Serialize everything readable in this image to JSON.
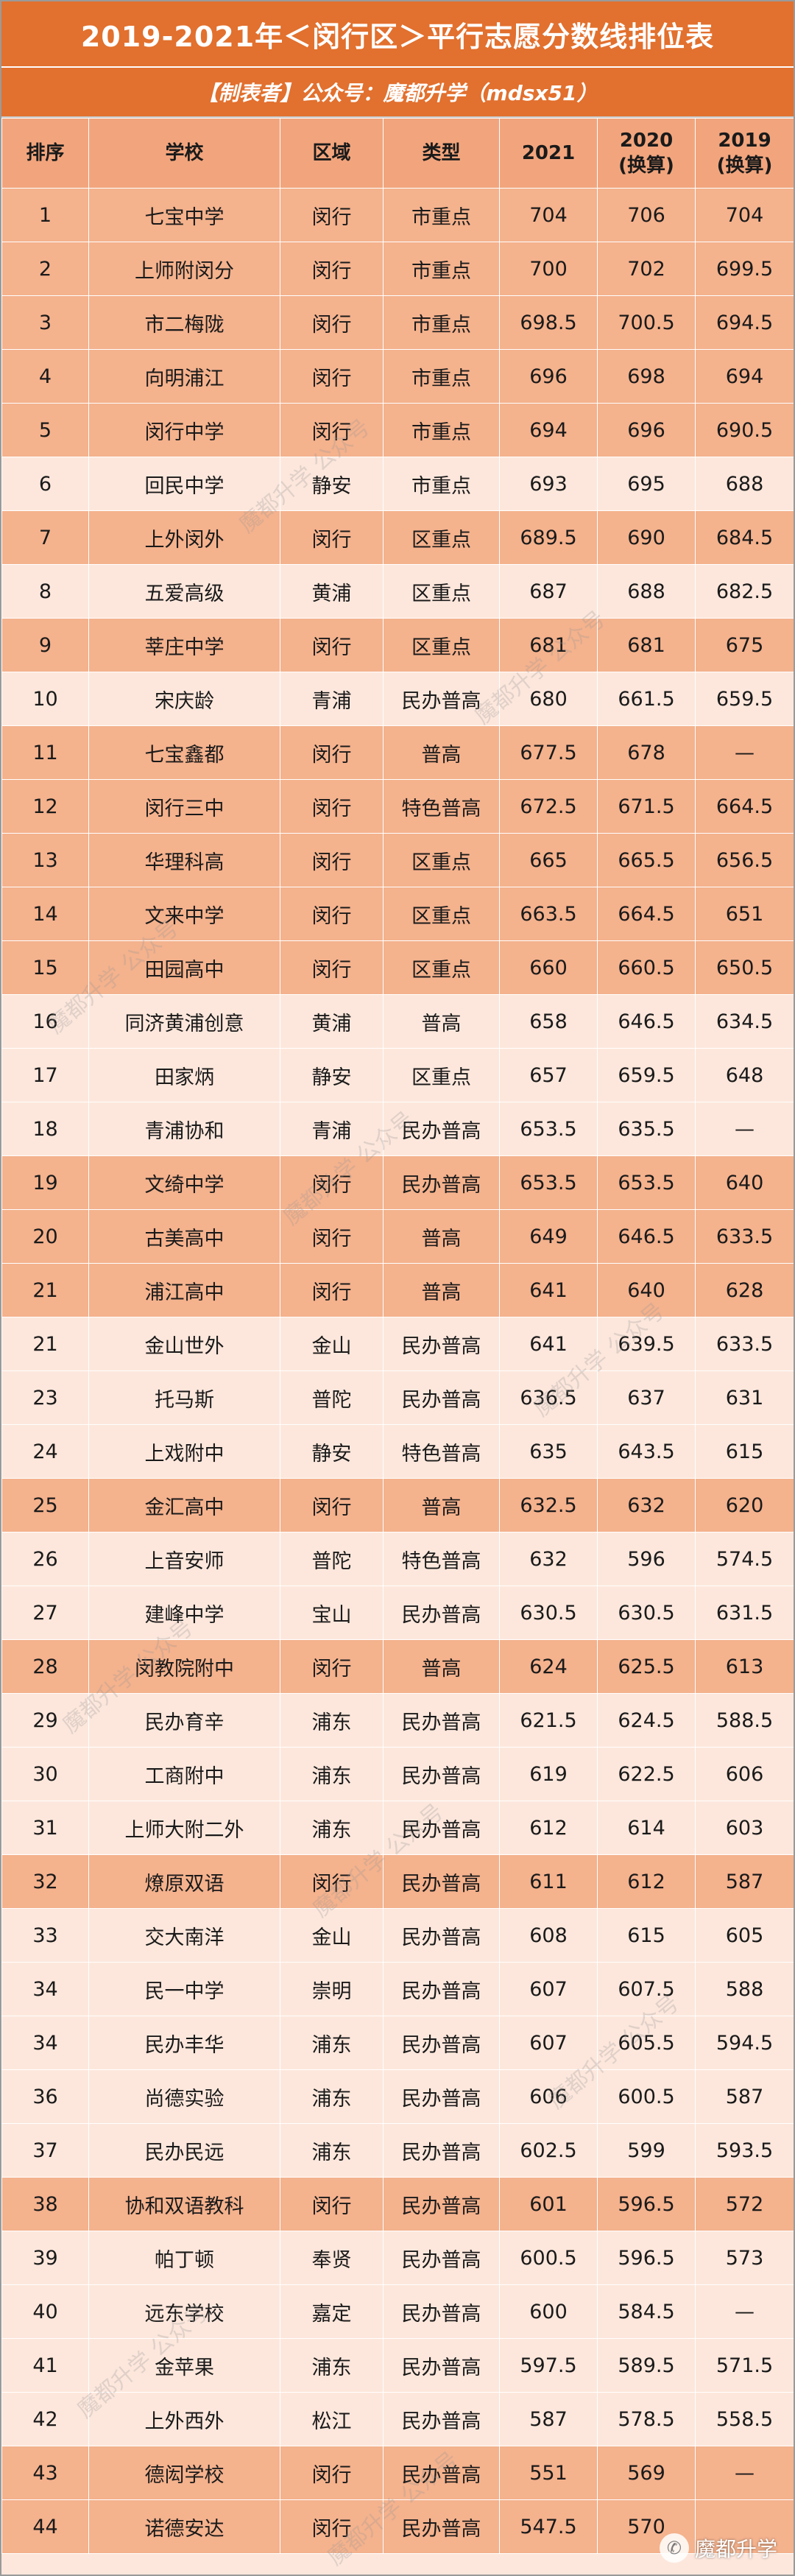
{
  "title": "2019-2021年＜闵行区＞平行志愿分数线排位表",
  "credit": "【制表者】公众号：魔都升学（mdsx51）",
  "columns": [
    "排序",
    "学校",
    "区域",
    "类型",
    "2021",
    "2020\n(换算)",
    "2019\n(换算)"
  ],
  "rows": [
    {
      "rank": "1",
      "school": "七宝中学",
      "district": "闵行",
      "type": "市重点",
      "y2021": "704",
      "y2020": "706",
      "y2019": "704",
      "highlight": true
    },
    {
      "rank": "2",
      "school": "上师附闵分",
      "district": "闵行",
      "type": "市重点",
      "y2021": "700",
      "y2020": "702",
      "y2019": "699.5",
      "highlight": true
    },
    {
      "rank": "3",
      "school": "市二梅陇",
      "district": "闵行",
      "type": "市重点",
      "y2021": "698.5",
      "y2020": "700.5",
      "y2019": "694.5",
      "highlight": true
    },
    {
      "rank": "4",
      "school": "向明浦江",
      "district": "闵行",
      "type": "市重点",
      "y2021": "696",
      "y2020": "698",
      "y2019": "694",
      "highlight": true
    },
    {
      "rank": "5",
      "school": "闵行中学",
      "district": "闵行",
      "type": "市重点",
      "y2021": "694",
      "y2020": "696",
      "y2019": "690.5",
      "highlight": true
    },
    {
      "rank": "6",
      "school": "回民中学",
      "district": "静安",
      "type": "市重点",
      "y2021": "693",
      "y2020": "695",
      "y2019": "688",
      "highlight": false
    },
    {
      "rank": "7",
      "school": "上外闵外",
      "district": "闵行",
      "type": "区重点",
      "y2021": "689.5",
      "y2020": "690",
      "y2019": "684.5",
      "highlight": true
    },
    {
      "rank": "8",
      "school": "五爱高级",
      "district": "黄浦",
      "type": "区重点",
      "y2021": "687",
      "y2020": "688",
      "y2019": "682.5",
      "highlight": false
    },
    {
      "rank": "9",
      "school": "莘庄中学",
      "district": "闵行",
      "type": "区重点",
      "y2021": "681",
      "y2020": "681",
      "y2019": "675",
      "highlight": true
    },
    {
      "rank": "10",
      "school": "宋庆龄",
      "district": "青浦",
      "type": "民办普高",
      "y2021": "680",
      "y2020": "661.5",
      "y2019": "659.5",
      "highlight": false
    },
    {
      "rank": "11",
      "school": "七宝鑫都",
      "district": "闵行",
      "type": "普高",
      "y2021": "677.5",
      "y2020": "678",
      "y2019": "—",
      "highlight": true
    },
    {
      "rank": "12",
      "school": "闵行三中",
      "district": "闵行",
      "type": "特色普高",
      "y2021": "672.5",
      "y2020": "671.5",
      "y2019": "664.5",
      "highlight": true
    },
    {
      "rank": "13",
      "school": "华理科高",
      "district": "闵行",
      "type": "区重点",
      "y2021": "665",
      "y2020": "665.5",
      "y2019": "656.5",
      "highlight": true
    },
    {
      "rank": "14",
      "school": "文来中学",
      "district": "闵行",
      "type": "区重点",
      "y2021": "663.5",
      "y2020": "664.5",
      "y2019": "651",
      "highlight": true
    },
    {
      "rank": "15",
      "school": "田园高中",
      "district": "闵行",
      "type": "区重点",
      "y2021": "660",
      "y2020": "660.5",
      "y2019": "650.5",
      "highlight": true
    },
    {
      "rank": "16",
      "school": "同济黄浦创意",
      "district": "黄浦",
      "type": "普高",
      "y2021": "658",
      "y2020": "646.5",
      "y2019": "634.5",
      "highlight": false
    },
    {
      "rank": "17",
      "school": "田家炳",
      "district": "静安",
      "type": "区重点",
      "y2021": "657",
      "y2020": "659.5",
      "y2019": "648",
      "highlight": false
    },
    {
      "rank": "18",
      "school": "青浦协和",
      "district": "青浦",
      "type": "民办普高",
      "y2021": "653.5",
      "y2020": "635.5",
      "y2019": "—",
      "highlight": false
    },
    {
      "rank": "19",
      "school": "文绮中学",
      "district": "闵行",
      "type": "民办普高",
      "y2021": "653.5",
      "y2020": "653.5",
      "y2019": "640",
      "highlight": true
    },
    {
      "rank": "20",
      "school": "古美高中",
      "district": "闵行",
      "type": "普高",
      "y2021": "649",
      "y2020": "646.5",
      "y2019": "633.5",
      "highlight": true
    },
    {
      "rank": "21",
      "school": "浦江高中",
      "district": "闵行",
      "type": "普高",
      "y2021": "641",
      "y2020": "640",
      "y2019": "628",
      "highlight": true
    },
    {
      "rank": "21",
      "school": "金山世外",
      "district": "金山",
      "type": "民办普高",
      "y2021": "641",
      "y2020": "639.5",
      "y2019": "633.5",
      "highlight": false
    },
    {
      "rank": "23",
      "school": "托马斯",
      "district": "普陀",
      "type": "民办普高",
      "y2021": "636.5",
      "y2020": "637",
      "y2019": "631",
      "highlight": false
    },
    {
      "rank": "24",
      "school": "上戏附中",
      "district": "静安",
      "type": "特色普高",
      "y2021": "635",
      "y2020": "643.5",
      "y2019": "615",
      "highlight": false
    },
    {
      "rank": "25",
      "school": "金汇高中",
      "district": "闵行",
      "type": "普高",
      "y2021": "632.5",
      "y2020": "632",
      "y2019": "620",
      "highlight": true
    },
    {
      "rank": "26",
      "school": "上音安师",
      "district": "普陀",
      "type": "特色普高",
      "y2021": "632",
      "y2020": "596",
      "y2019": "574.5",
      "highlight": false
    },
    {
      "rank": "27",
      "school": "建峰中学",
      "district": "宝山",
      "type": "民办普高",
      "y2021": "630.5",
      "y2020": "630.5",
      "y2019": "631.5",
      "highlight": false
    },
    {
      "rank": "28",
      "school": "闵教院附中",
      "district": "闵行",
      "type": "普高",
      "y2021": "624",
      "y2020": "625.5",
      "y2019": "613",
      "highlight": true
    },
    {
      "rank": "29",
      "school": "民办育辛",
      "district": "浦东",
      "type": "民办普高",
      "y2021": "621.5",
      "y2020": "624.5",
      "y2019": "588.5",
      "highlight": false
    },
    {
      "rank": "30",
      "school": "工商附中",
      "district": "浦东",
      "type": "民办普高",
      "y2021": "619",
      "y2020": "622.5",
      "y2019": "606",
      "highlight": false
    },
    {
      "rank": "31",
      "school": "上师大附二外",
      "district": "浦东",
      "type": "民办普高",
      "y2021": "612",
      "y2020": "614",
      "y2019": "603",
      "highlight": false
    },
    {
      "rank": "32",
      "school": "燎原双语",
      "district": "闵行",
      "type": "民办普高",
      "y2021": "611",
      "y2020": "612",
      "y2019": "587",
      "highlight": true
    },
    {
      "rank": "33",
      "school": "交大南洋",
      "district": "金山",
      "type": "民办普高",
      "y2021": "608",
      "y2020": "615",
      "y2019": "605",
      "highlight": false
    },
    {
      "rank": "34",
      "school": "民一中学",
      "district": "崇明",
      "type": "民办普高",
      "y2021": "607",
      "y2020": "607.5",
      "y2019": "588",
      "highlight": false
    },
    {
      "rank": "34",
      "school": "民办丰华",
      "district": "浦东",
      "type": "民办普高",
      "y2021": "607",
      "y2020": "605.5",
      "y2019": "594.5",
      "highlight": false
    },
    {
      "rank": "36",
      "school": "尚德实验",
      "district": "浦东",
      "type": "民办普高",
      "y2021": "606",
      "y2020": "600.5",
      "y2019": "587",
      "highlight": false
    },
    {
      "rank": "37",
      "school": "民办民远",
      "district": "浦东",
      "type": "民办普高",
      "y2021": "602.5",
      "y2020": "599",
      "y2019": "593.5",
      "highlight": false
    },
    {
      "rank": "38",
      "school": "协和双语教科",
      "district": "闵行",
      "type": "民办普高",
      "y2021": "601",
      "y2020": "596.5",
      "y2019": "572",
      "highlight": true
    },
    {
      "rank": "39",
      "school": "帕丁顿",
      "district": "奉贤",
      "type": "民办普高",
      "y2021": "600.5",
      "y2020": "596.5",
      "y2019": "573",
      "highlight": false
    },
    {
      "rank": "40",
      "school": "远东学校",
      "district": "嘉定",
      "type": "民办普高",
      "y2021": "600",
      "y2020": "584.5",
      "y2019": "—",
      "highlight": false
    },
    {
      "rank": "41",
      "school": "金苹果",
      "district": "浦东",
      "type": "民办普高",
      "y2021": "597.5",
      "y2020": "589.5",
      "y2019": "571.5",
      "highlight": false
    },
    {
      "rank": "42",
      "school": "上外西外",
      "district": "松江",
      "type": "民办普高",
      "y2021": "587",
      "y2020": "578.5",
      "y2019": "558.5",
      "highlight": false
    },
    {
      "rank": "43",
      "school": "德闳学校",
      "district": "闵行",
      "type": "民办普高",
      "y2021": "551",
      "y2020": "569",
      "y2019": "—",
      "highlight": true
    },
    {
      "rank": "44",
      "school": "诺德安达",
      "district": "闵行",
      "type": "民办普高",
      "y2021": "547.5",
      "y2020": "570",
      "y2019": "",
      "highlight": true
    }
  ],
  "watermark": "魔都升学 公众号",
  "logo": {
    "icon": "wechat-icon",
    "text": "魔都升学"
  }
}
